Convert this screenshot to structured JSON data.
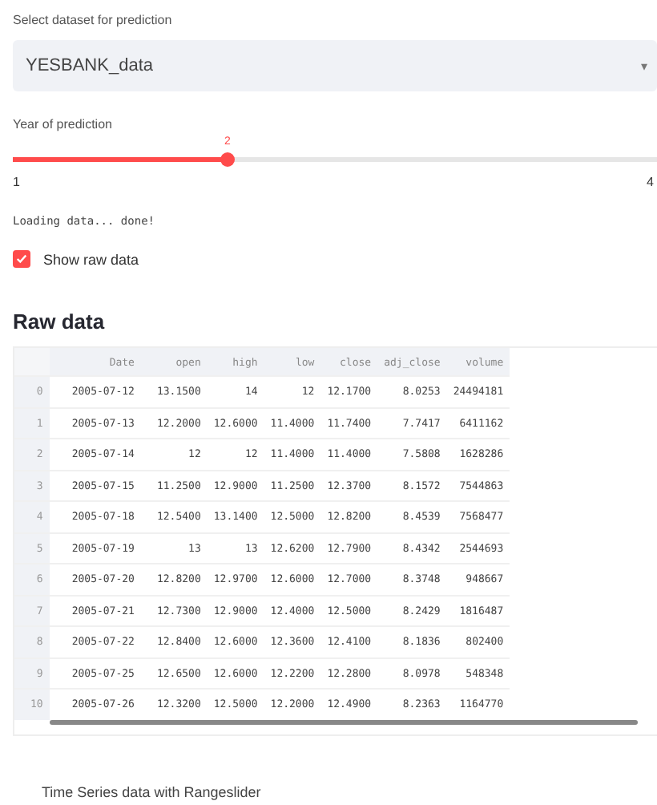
{
  "dataset_select": {
    "label": "Select dataset for prediction",
    "value": "YESBANK_data",
    "caret": "▾"
  },
  "year_slider": {
    "label": "Year of prediction",
    "value": "2",
    "level": 0.3333,
    "min": "1",
    "max": "4"
  },
  "status": "Loading data... done!",
  "show_raw": {
    "label": "Show raw data",
    "checked": true
  },
  "heading": "Raw data",
  "table": {
    "columns": [
      "",
      "Date",
      "open",
      "high",
      "low",
      "close",
      "adj_close",
      "volume"
    ],
    "rows": [
      [
        "0",
        "2005-07-12",
        "13.1500",
        "14",
        "12",
        "12.1700",
        "8.0253",
        "24494181"
      ],
      [
        "1",
        "2005-07-13",
        "12.2000",
        "12.6000",
        "11.4000",
        "11.7400",
        "7.7417",
        "6411162"
      ],
      [
        "2",
        "2005-07-14",
        "12",
        "12",
        "11.4000",
        "11.4000",
        "7.5808",
        "1628286"
      ],
      [
        "3",
        "2005-07-15",
        "11.2500",
        "12.9000",
        "11.2500",
        "12.3700",
        "8.1572",
        "7544863"
      ],
      [
        "4",
        "2005-07-18",
        "12.5400",
        "13.1400",
        "12.5000",
        "12.8200",
        "8.4539",
        "7568477"
      ],
      [
        "5",
        "2005-07-19",
        "13",
        "13",
        "12.6200",
        "12.7900",
        "8.4342",
        "2544693"
      ],
      [
        "6",
        "2005-07-20",
        "12.8200",
        "12.9700",
        "12.6000",
        "12.7000",
        "8.3748",
        "948667"
      ],
      [
        "7",
        "2005-07-21",
        "12.7300",
        "12.9000",
        "12.4000",
        "12.5000",
        "8.2429",
        "1816487"
      ],
      [
        "8",
        "2005-07-22",
        "12.8400",
        "12.6000",
        "12.3600",
        "12.4100",
        "8.1836",
        "802400"
      ],
      [
        "9",
        "2005-07-25",
        "12.6500",
        "12.6000",
        "12.2200",
        "12.2800",
        "8.0978",
        "548348"
      ],
      [
        "10",
        "2005-07-26",
        "12.3200",
        "12.5000",
        "12.2000",
        "12.4900",
        "8.2363",
        "1164770"
      ]
    ]
  },
  "chart_title": "Time Series data with Rangeslider"
}
